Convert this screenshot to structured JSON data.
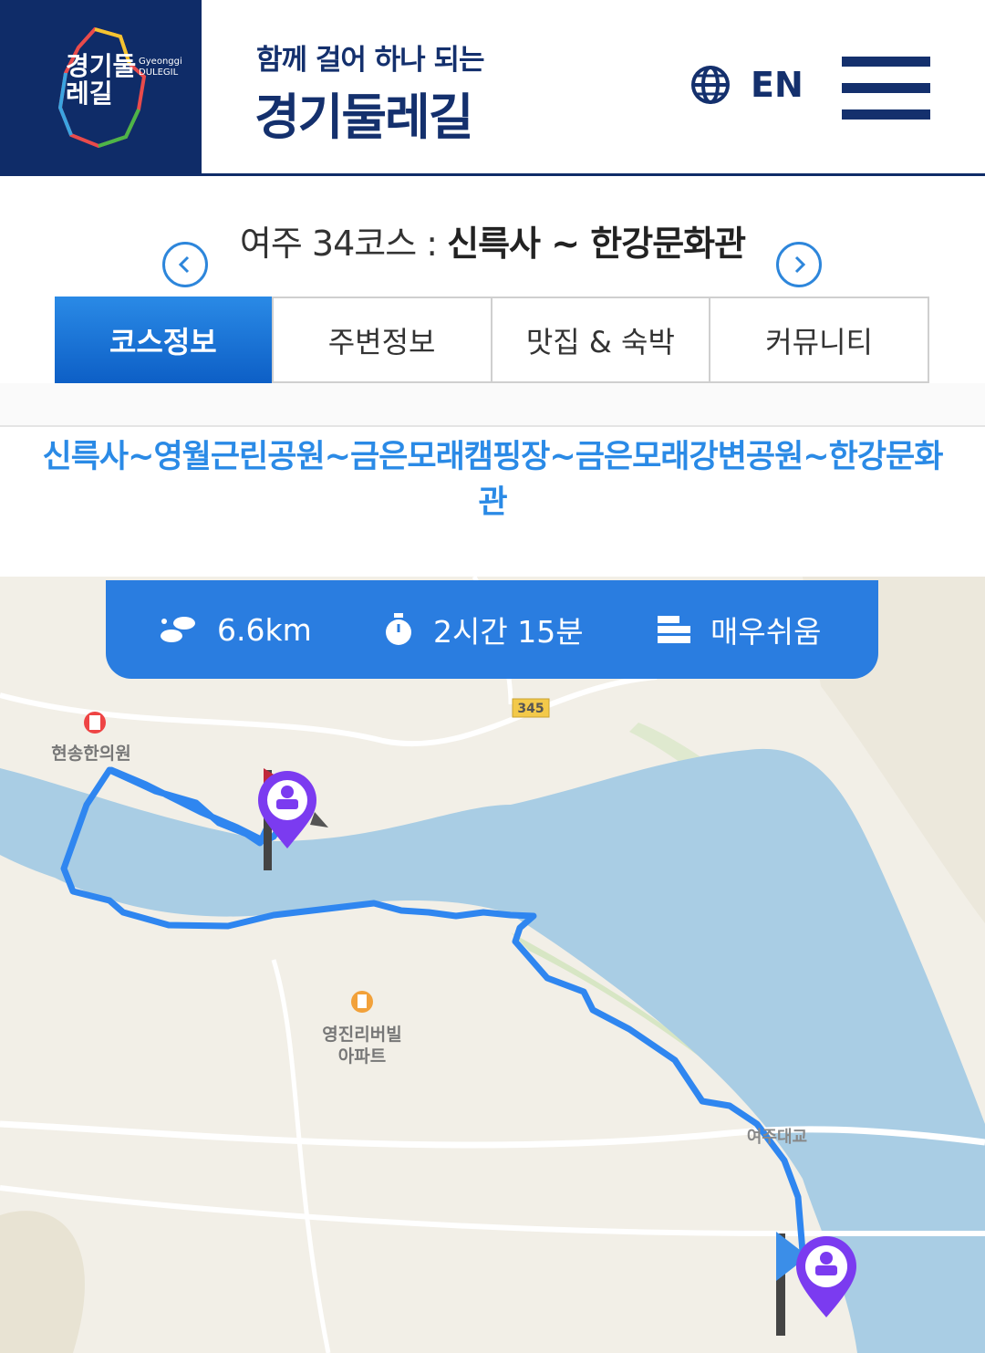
{
  "header": {
    "logo_text": "경기둘레길",
    "logo_en_line1": "Gyeonggi",
    "logo_en_line2": "DULEGIL",
    "brand_sub": "함께 걸어 하나 되는",
    "brand_main": "경기둘레길",
    "lang_label": "EN",
    "brand_color": "#0f2c68"
  },
  "course": {
    "prefix": "여주 34코스 : ",
    "name": "신륵사 ~ 한강문화관"
  },
  "tabs": [
    {
      "label": "코스정보",
      "active": true
    },
    {
      "label": "주변정보",
      "active": false
    },
    {
      "label": "맛집 & 숙박",
      "active": false
    },
    {
      "label": "커뮤니티",
      "active": false
    }
  ],
  "route_names": "신륵사~영월근린공원~금은모래캠핑장~금은모래강변공원~한강문화관",
  "stats": {
    "distance": "6.6km",
    "duration": "2시간 15분",
    "difficulty": "매우쉬움"
  },
  "map_labels": {
    "road_number": "345",
    "clinic": "현송한의원",
    "apartment_line1": "영진리버빌",
    "apartment_line2": "아파트",
    "bridge": "여주대교"
  },
  "colors": {
    "accent": "#2a7de0",
    "route": "#2f86f0",
    "river": "#a9cde4",
    "marker": "#7b3bf0"
  }
}
